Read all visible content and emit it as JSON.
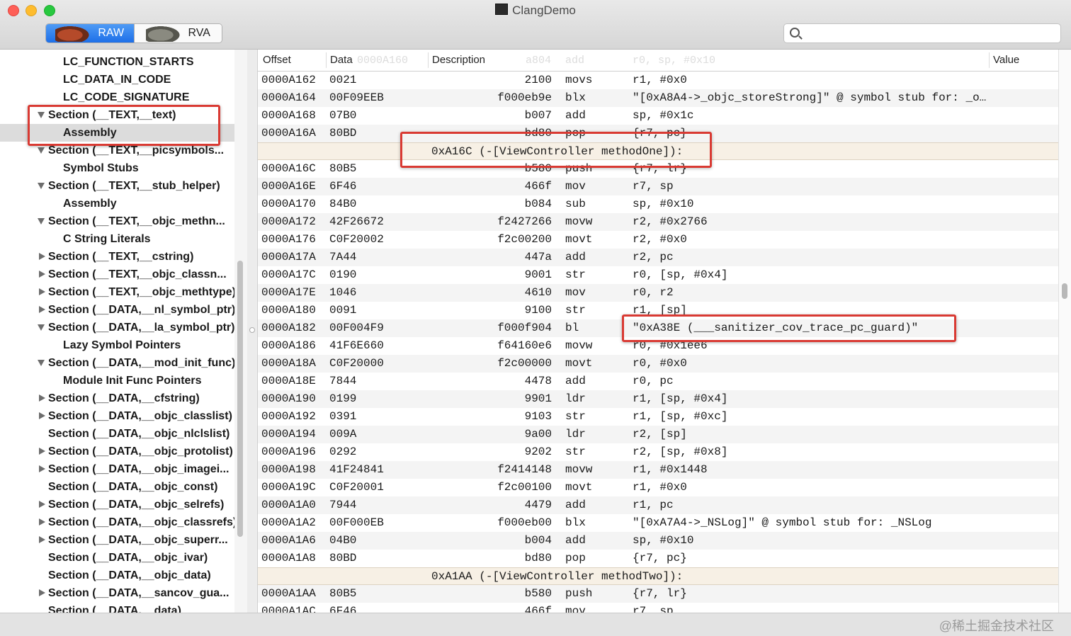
{
  "window": {
    "title": "ClangDemo"
  },
  "toolbar": {
    "mode_raw": "RAW",
    "mode_rva": "RVA",
    "search_placeholder": "",
    "selected_mode": "RAW"
  },
  "sidebar": {
    "items": [
      {
        "label": "LC_FUNCTION_STARTS",
        "level": 2,
        "disclosure": "none",
        "selected": false
      },
      {
        "label": "LC_DATA_IN_CODE",
        "level": 2,
        "disclosure": "none",
        "selected": false
      },
      {
        "label": "LC_CODE_SIGNATURE",
        "level": 2,
        "disclosure": "none",
        "selected": false
      },
      {
        "label": "Section (__TEXT,__text)",
        "level": 1,
        "disclosure": "open",
        "selected": false
      },
      {
        "label": "Assembly",
        "level": 2,
        "disclosure": "none",
        "selected": true
      },
      {
        "label": "Section (__TEXT,__picsymbols...",
        "level": 1,
        "disclosure": "open",
        "selected": false
      },
      {
        "label": "Symbol Stubs",
        "level": 2,
        "disclosure": "none",
        "selected": false
      },
      {
        "label": "Section (__TEXT,__stub_helper)",
        "level": 1,
        "disclosure": "open",
        "selected": false
      },
      {
        "label": "Assembly",
        "level": 2,
        "disclosure": "none",
        "selected": false
      },
      {
        "label": "Section (__TEXT,__objc_methn...",
        "level": 1,
        "disclosure": "open",
        "selected": false
      },
      {
        "label": "C String Literals",
        "level": 2,
        "disclosure": "none",
        "selected": false
      },
      {
        "label": "Section (__TEXT,__cstring)",
        "level": 1,
        "disclosure": "closed",
        "selected": false
      },
      {
        "label": "Section (__TEXT,__objc_classn...",
        "level": 1,
        "disclosure": "closed",
        "selected": false
      },
      {
        "label": "Section (__TEXT,__objc_methtype)",
        "level": 1,
        "disclosure": "closed",
        "selected": false
      },
      {
        "label": "Section (__DATA,__nl_symbol_ptr)",
        "level": 1,
        "disclosure": "closed",
        "selected": false
      },
      {
        "label": "Section (__DATA,__la_symbol_ptr)",
        "level": 1,
        "disclosure": "open",
        "selected": false
      },
      {
        "label": "Lazy Symbol Pointers",
        "level": 2,
        "disclosure": "none",
        "selected": false
      },
      {
        "label": "Section (__DATA,__mod_init_func)",
        "level": 1,
        "disclosure": "open",
        "selected": false
      },
      {
        "label": "Module Init Func Pointers",
        "level": 2,
        "disclosure": "none",
        "selected": false
      },
      {
        "label": "Section (__DATA,__cfstring)",
        "level": 1,
        "disclosure": "closed",
        "selected": false
      },
      {
        "label": "Section (__DATA,__objc_classlist)",
        "level": 1,
        "disclosure": "closed",
        "selected": false
      },
      {
        "label": "Section (__DATA,__objc_nlclslist)",
        "level": 1,
        "disclosure": "none",
        "selected": false
      },
      {
        "label": "Section (__DATA,__objc_protolist)",
        "level": 1,
        "disclosure": "closed",
        "selected": false
      },
      {
        "label": "Section (__DATA,__objc_imagei...",
        "level": 1,
        "disclosure": "closed",
        "selected": false
      },
      {
        "label": "Section (__DATA,__objc_const)",
        "level": 1,
        "disclosure": "none",
        "selected": false
      },
      {
        "label": "Section (__DATA,__objc_selrefs)",
        "level": 1,
        "disclosure": "closed",
        "selected": false
      },
      {
        "label": "Section (__DATA,__objc_classrefs)",
        "level": 1,
        "disclosure": "closed",
        "selected": false
      },
      {
        "label": "Section (__DATA,__objc_superr...",
        "level": 1,
        "disclosure": "closed",
        "selected": false
      },
      {
        "label": "Section (__DATA,__objc_ivar)",
        "level": 1,
        "disclosure": "none",
        "selected": false
      },
      {
        "label": "Section (__DATA,__objc_data)",
        "level": 1,
        "disclosure": "none",
        "selected": false
      },
      {
        "label": "Section (__DATA,__sancov_gua...",
        "level": 1,
        "disclosure": "closed",
        "selected": false
      },
      {
        "label": "Section (__DATA,__data)",
        "level": 1,
        "disclosure": "none",
        "selected": false
      }
    ]
  },
  "table": {
    "columns": [
      "Offset",
      "Data",
      "Description",
      "Value"
    ],
    "header_ghost": {
      "offset": "0000A160",
      "hex": "a804",
      "mnemonic": "add",
      "operands": "r0, sp, #0x10"
    },
    "rows": [
      {
        "type": "ins",
        "offset": "0000A162",
        "data": "0021",
        "hex": "2100",
        "mnemonic": "movs",
        "operands": "r1, #0x0"
      },
      {
        "type": "ins",
        "offset": "0000A164",
        "data": "00F09EEB",
        "hex": "f000eb9e",
        "mnemonic": "blx",
        "operands": "\"[0xA8A4->_objc_storeStrong]\" @ symbol stub for: _o…"
      },
      {
        "type": "ins",
        "offset": "0000A168",
        "data": "07B0",
        "hex": "b007",
        "mnemonic": "add",
        "operands": "sp, #0x1c"
      },
      {
        "type": "ins",
        "offset": "0000A16A",
        "data": "80BD",
        "hex": "bd80",
        "mnemonic": "pop",
        "operands": "{r7, pc}"
      },
      {
        "type": "label",
        "text": "0xA16C (-[ViewController methodOne]):"
      },
      {
        "type": "ins",
        "offset": "0000A16C",
        "data": "80B5",
        "hex": "b580",
        "mnemonic": "push",
        "operands": "{r7, lr}"
      },
      {
        "type": "ins",
        "offset": "0000A16E",
        "data": "6F46",
        "hex": "466f",
        "mnemonic": "mov",
        "operands": "r7, sp"
      },
      {
        "type": "ins",
        "offset": "0000A170",
        "data": "84B0",
        "hex": "b084",
        "mnemonic": "sub",
        "operands": "sp, #0x10"
      },
      {
        "type": "ins",
        "offset": "0000A172",
        "data": "42F26672",
        "hex": "f2427266",
        "mnemonic": "movw",
        "operands": "r2, #0x2766"
      },
      {
        "type": "ins",
        "offset": "0000A176",
        "data": "C0F20002",
        "hex": "f2c00200",
        "mnemonic": "movt",
        "operands": "r2, #0x0"
      },
      {
        "type": "ins",
        "offset": "0000A17A",
        "data": "7A44",
        "hex": "447a",
        "mnemonic": "add",
        "operands": "r2, pc"
      },
      {
        "type": "ins",
        "offset": "0000A17C",
        "data": "0190",
        "hex": "9001",
        "mnemonic": "str",
        "operands": "r0, [sp, #0x4]"
      },
      {
        "type": "ins",
        "offset": "0000A17E",
        "data": "1046",
        "hex": "4610",
        "mnemonic": "mov",
        "operands": "r0, r2"
      },
      {
        "type": "ins",
        "offset": "0000A180",
        "data": "0091",
        "hex": "9100",
        "mnemonic": "str",
        "operands": "r1, [sp]"
      },
      {
        "type": "ins",
        "offset": "0000A182",
        "data": "00F004F9",
        "hex": "f000f904",
        "mnemonic": "bl",
        "operands": "\"0xA38E (___sanitizer_cov_trace_pc_guard)\""
      },
      {
        "type": "ins",
        "offset": "0000A186",
        "data": "41F6E660",
        "hex": "f64160e6",
        "mnemonic": "movw",
        "operands": "r0, #0x1ee6"
      },
      {
        "type": "ins",
        "offset": "0000A18A",
        "data": "C0F20000",
        "hex": "f2c00000",
        "mnemonic": "movt",
        "operands": "r0, #0x0"
      },
      {
        "type": "ins",
        "offset": "0000A18E",
        "data": "7844",
        "hex": "4478",
        "mnemonic": "add",
        "operands": "r0, pc"
      },
      {
        "type": "ins",
        "offset": "0000A190",
        "data": "0199",
        "hex": "9901",
        "mnemonic": "ldr",
        "operands": "r1, [sp, #0x4]"
      },
      {
        "type": "ins",
        "offset": "0000A192",
        "data": "0391",
        "hex": "9103",
        "mnemonic": "str",
        "operands": "r1, [sp, #0xc]"
      },
      {
        "type": "ins",
        "offset": "0000A194",
        "data": "009A",
        "hex": "9a00",
        "mnemonic": "ldr",
        "operands": "r2, [sp]"
      },
      {
        "type": "ins",
        "offset": "0000A196",
        "data": "0292",
        "hex": "9202",
        "mnemonic": "str",
        "operands": "r2, [sp, #0x8]"
      },
      {
        "type": "ins",
        "offset": "0000A198",
        "data": "41F24841",
        "hex": "f2414148",
        "mnemonic": "movw",
        "operands": "r1, #0x1448"
      },
      {
        "type": "ins",
        "offset": "0000A19C",
        "data": "C0F20001",
        "hex": "f2c00100",
        "mnemonic": "movt",
        "operands": "r1, #0x0"
      },
      {
        "type": "ins",
        "offset": "0000A1A0",
        "data": "7944",
        "hex": "4479",
        "mnemonic": "add",
        "operands": "r1, pc"
      },
      {
        "type": "ins",
        "offset": "0000A1A2",
        "data": "00F000EB",
        "hex": "f000eb00",
        "mnemonic": "blx",
        "operands": "\"[0xA7A4->_NSLog]\" @ symbol stub for: _NSLog"
      },
      {
        "type": "ins",
        "offset": "0000A1A6",
        "data": "04B0",
        "hex": "b004",
        "mnemonic": "add",
        "operands": "sp, #0x10"
      },
      {
        "type": "ins",
        "offset": "0000A1A8",
        "data": "80BD",
        "hex": "bd80",
        "mnemonic": "pop",
        "operands": "{r7, pc}"
      },
      {
        "type": "label",
        "text": "0xA1AA (-[ViewController methodTwo]):"
      },
      {
        "type": "ins",
        "offset": "0000A1AA",
        "data": "80B5",
        "hex": "b580",
        "mnemonic": "push",
        "operands": "{r7, lr}"
      },
      {
        "type": "ins",
        "offset": "0000A1AC",
        "data": "6F46",
        "hex": "466f",
        "mnemonic": "mov",
        "operands": "r7, sp"
      }
    ]
  },
  "statusbar": {
    "watermark": "@稀土掘金技术社区"
  },
  "colors": {
    "highlight": "#d93a33",
    "selection": "#dcdcdc",
    "label_row": "#f7f0e5",
    "raw_button": "#1d6fe8"
  }
}
